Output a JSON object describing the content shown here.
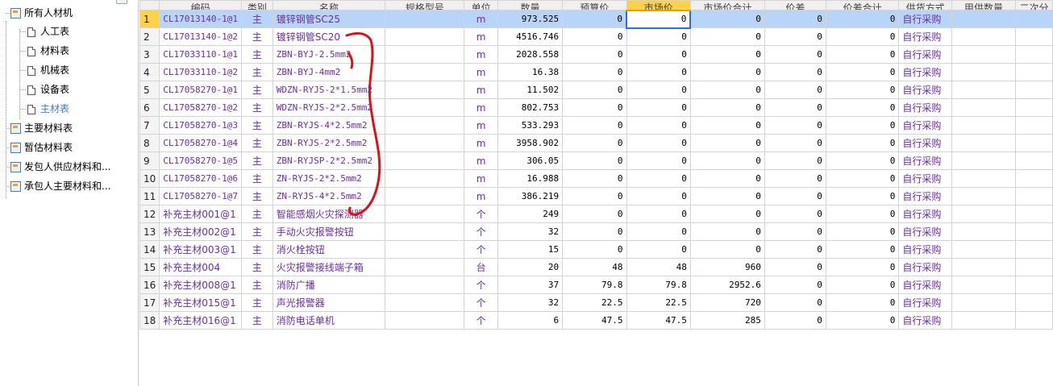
{
  "tree": {
    "items": [
      {
        "label": "所有人材机",
        "level": 0,
        "icon": "folder-tree-icon"
      },
      {
        "label": "人工表",
        "level": 1,
        "icon": "document-icon"
      },
      {
        "label": "材料表",
        "level": 1,
        "icon": "document-icon"
      },
      {
        "label": "机械表",
        "level": 1,
        "icon": "document-icon"
      },
      {
        "label": "设备表",
        "level": 1,
        "icon": "document-icon"
      },
      {
        "label": "主材表",
        "level": 1,
        "icon": "document-icon",
        "selected": true
      },
      {
        "label": "主要材料表",
        "level": 0,
        "icon": "folder-tree-icon"
      },
      {
        "label": "暂估材料表",
        "level": 0,
        "icon": "folder-tree-icon"
      },
      {
        "label": "发包人供应材料和...",
        "level": 0,
        "icon": "folder-tree-icon"
      },
      {
        "label": "承包人主要材料和...",
        "level": 0,
        "icon": "folder-tree-icon"
      }
    ]
  },
  "grid": {
    "headers": [
      "编码",
      "类别",
      "名称",
      "规格型号",
      "单位",
      "数量",
      "预算价",
      "市场价",
      "市场价合计",
      "价差",
      "价差合计",
      "供货方式",
      "甲供数量",
      "二次分"
    ],
    "active_header_index": 7,
    "rows": [
      {
        "no": "1",
        "code": "CL17013140-1@1",
        "type": "主",
        "name": "镀锌钢管SC25",
        "spec": "",
        "unit": "m",
        "qty": "973.525",
        "budget": "0",
        "market": "0",
        "market_total": "0",
        "diff": "0",
        "diff_total": "0",
        "supply": "自行采购",
        "owner_qty": "",
        "extra": ""
      },
      {
        "no": "2",
        "code": "CL17013140-1@2",
        "type": "主",
        "name": "镀锌钢管SC20",
        "spec": "",
        "unit": "m",
        "qty": "4516.746",
        "budget": "0",
        "market": "0",
        "market_total": "0",
        "diff": "0",
        "diff_total": "0",
        "supply": "自行采购",
        "owner_qty": "",
        "extra": ""
      },
      {
        "no": "3",
        "code": "CL17033110-1@1",
        "type": "主",
        "name": "ZBN-BYJ-2.5mm2",
        "spec": "",
        "unit": "m",
        "qty": "2028.558",
        "budget": "0",
        "market": "0",
        "market_total": "0",
        "diff": "0",
        "diff_total": "0",
        "supply": "自行采购",
        "owner_qty": "",
        "extra": ""
      },
      {
        "no": "4",
        "code": "CL17033110-1@2",
        "type": "主",
        "name": "ZBN-BYJ-4mm2",
        "spec": "",
        "unit": "m",
        "qty": "16.38",
        "budget": "0",
        "market": "0",
        "market_total": "0",
        "diff": "0",
        "diff_total": "0",
        "supply": "自行采购",
        "owner_qty": "",
        "extra": ""
      },
      {
        "no": "5",
        "code": "CL17058270-1@1",
        "type": "主",
        "name": "WDZN-RYJS-2*1.5mm2",
        "spec": "",
        "unit": "m",
        "qty": "11.502",
        "budget": "0",
        "market": "0",
        "market_total": "0",
        "diff": "0",
        "diff_total": "0",
        "supply": "自行采购",
        "owner_qty": "",
        "extra": ""
      },
      {
        "no": "6",
        "code": "CL17058270-1@2",
        "type": "主",
        "name": "WDZN-RYJS-2*2.5mm2",
        "spec": "",
        "unit": "m",
        "qty": "802.753",
        "budget": "0",
        "market": "0",
        "market_total": "0",
        "diff": "0",
        "diff_total": "0",
        "supply": "自行采购",
        "owner_qty": "",
        "extra": ""
      },
      {
        "no": "7",
        "code": "CL17058270-1@3",
        "type": "主",
        "name": "ZBN-RYJS-4*2.5mm2",
        "spec": "",
        "unit": "m",
        "qty": "533.293",
        "budget": "0",
        "market": "0",
        "market_total": "0",
        "diff": "0",
        "diff_total": "0",
        "supply": "自行采购",
        "owner_qty": "",
        "extra": ""
      },
      {
        "no": "8",
        "code": "CL17058270-1@4",
        "type": "主",
        "name": "ZBN-RYJS-2*2.5mm2",
        "spec": "",
        "unit": "m",
        "qty": "3958.902",
        "budget": "0",
        "market": "0",
        "market_total": "0",
        "diff": "0",
        "diff_total": "0",
        "supply": "自行采购",
        "owner_qty": "",
        "extra": ""
      },
      {
        "no": "9",
        "code": "CL17058270-1@5",
        "type": "主",
        "name": "ZBN-RYJSP-2*2.5mm2",
        "spec": "",
        "unit": "m",
        "qty": "306.05",
        "budget": "0",
        "market": "0",
        "market_total": "0",
        "diff": "0",
        "diff_total": "0",
        "supply": "自行采购",
        "owner_qty": "",
        "extra": ""
      },
      {
        "no": "10",
        "code": "CL17058270-1@6",
        "type": "主",
        "name": "ZN-RYJS-2*2.5mm2",
        "spec": "",
        "unit": "m",
        "qty": "16.988",
        "budget": "0",
        "market": "0",
        "market_total": "0",
        "diff": "0",
        "diff_total": "0",
        "supply": "自行采购",
        "owner_qty": "",
        "extra": ""
      },
      {
        "no": "11",
        "code": "CL17058270-1@7",
        "type": "主",
        "name": "ZN-RYJS-4*2.5mm2",
        "spec": "",
        "unit": "m",
        "qty": "386.219",
        "budget": "0",
        "market": "0",
        "market_total": "0",
        "diff": "0",
        "diff_total": "0",
        "supply": "自行采购",
        "owner_qty": "",
        "extra": ""
      },
      {
        "no": "12",
        "code": "补充主材001@1",
        "type": "主",
        "name": "智能感烟火灾探测器",
        "spec": "",
        "unit": "个",
        "qty": "249",
        "budget": "0",
        "market": "0",
        "market_total": "0",
        "diff": "0",
        "diff_total": "0",
        "supply": "自行采购",
        "owner_qty": "",
        "extra": ""
      },
      {
        "no": "13",
        "code": "补充主材002@1",
        "type": "主",
        "name": "手动火灾报警按钮",
        "spec": "",
        "unit": "个",
        "qty": "32",
        "budget": "0",
        "market": "0",
        "market_total": "0",
        "diff": "0",
        "diff_total": "0",
        "supply": "自行采购",
        "owner_qty": "",
        "extra": ""
      },
      {
        "no": "14",
        "code": "补充主材003@1",
        "type": "主",
        "name": "消火栓按钮",
        "spec": "",
        "unit": "个",
        "qty": "15",
        "budget": "0",
        "market": "0",
        "market_total": "0",
        "diff": "0",
        "diff_total": "0",
        "supply": "自行采购",
        "owner_qty": "",
        "extra": ""
      },
      {
        "no": "15",
        "code": "补充主材004",
        "type": "主",
        "name": "火灾报警接线端子箱",
        "spec": "",
        "unit": "台",
        "qty": "20",
        "budget": "48",
        "market": "48",
        "market_total": "960",
        "diff": "0",
        "diff_total": "0",
        "supply": "自行采购",
        "owner_qty": "",
        "extra": ""
      },
      {
        "no": "16",
        "code": "补充主材008@1",
        "type": "主",
        "name": "消防广播",
        "spec": "",
        "unit": "个",
        "qty": "37",
        "budget": "79.8",
        "market": "79.8",
        "market_total": "2952.6",
        "diff": "0",
        "diff_total": "0",
        "supply": "自行采购",
        "owner_qty": "",
        "extra": ""
      },
      {
        "no": "17",
        "code": "补充主材015@1",
        "type": "主",
        "name": "声光报警器",
        "spec": "",
        "unit": "个",
        "qty": "32",
        "budget": "22.5",
        "market": "22.5",
        "market_total": "720",
        "diff": "0",
        "diff_total": "0",
        "supply": "自行采购",
        "owner_qty": "",
        "extra": ""
      },
      {
        "no": "18",
        "code": "补充主材016@1",
        "type": "主",
        "name": "消防电话单机",
        "spec": "",
        "unit": "个",
        "qty": "6",
        "budget": "47.5",
        "market": "47.5",
        "market_total": "285",
        "diff": "0",
        "diff_total": "0",
        "supply": "自行采购",
        "owner_qty": "",
        "extra": ""
      }
    ],
    "selected_row": 0
  },
  "colors": {
    "accent": "#3a7dd8",
    "selection": "#b8d4f8",
    "active_header": "#ffd24a",
    "text_purple": "#6b2fa0",
    "annotation_red": "#d8131b"
  }
}
